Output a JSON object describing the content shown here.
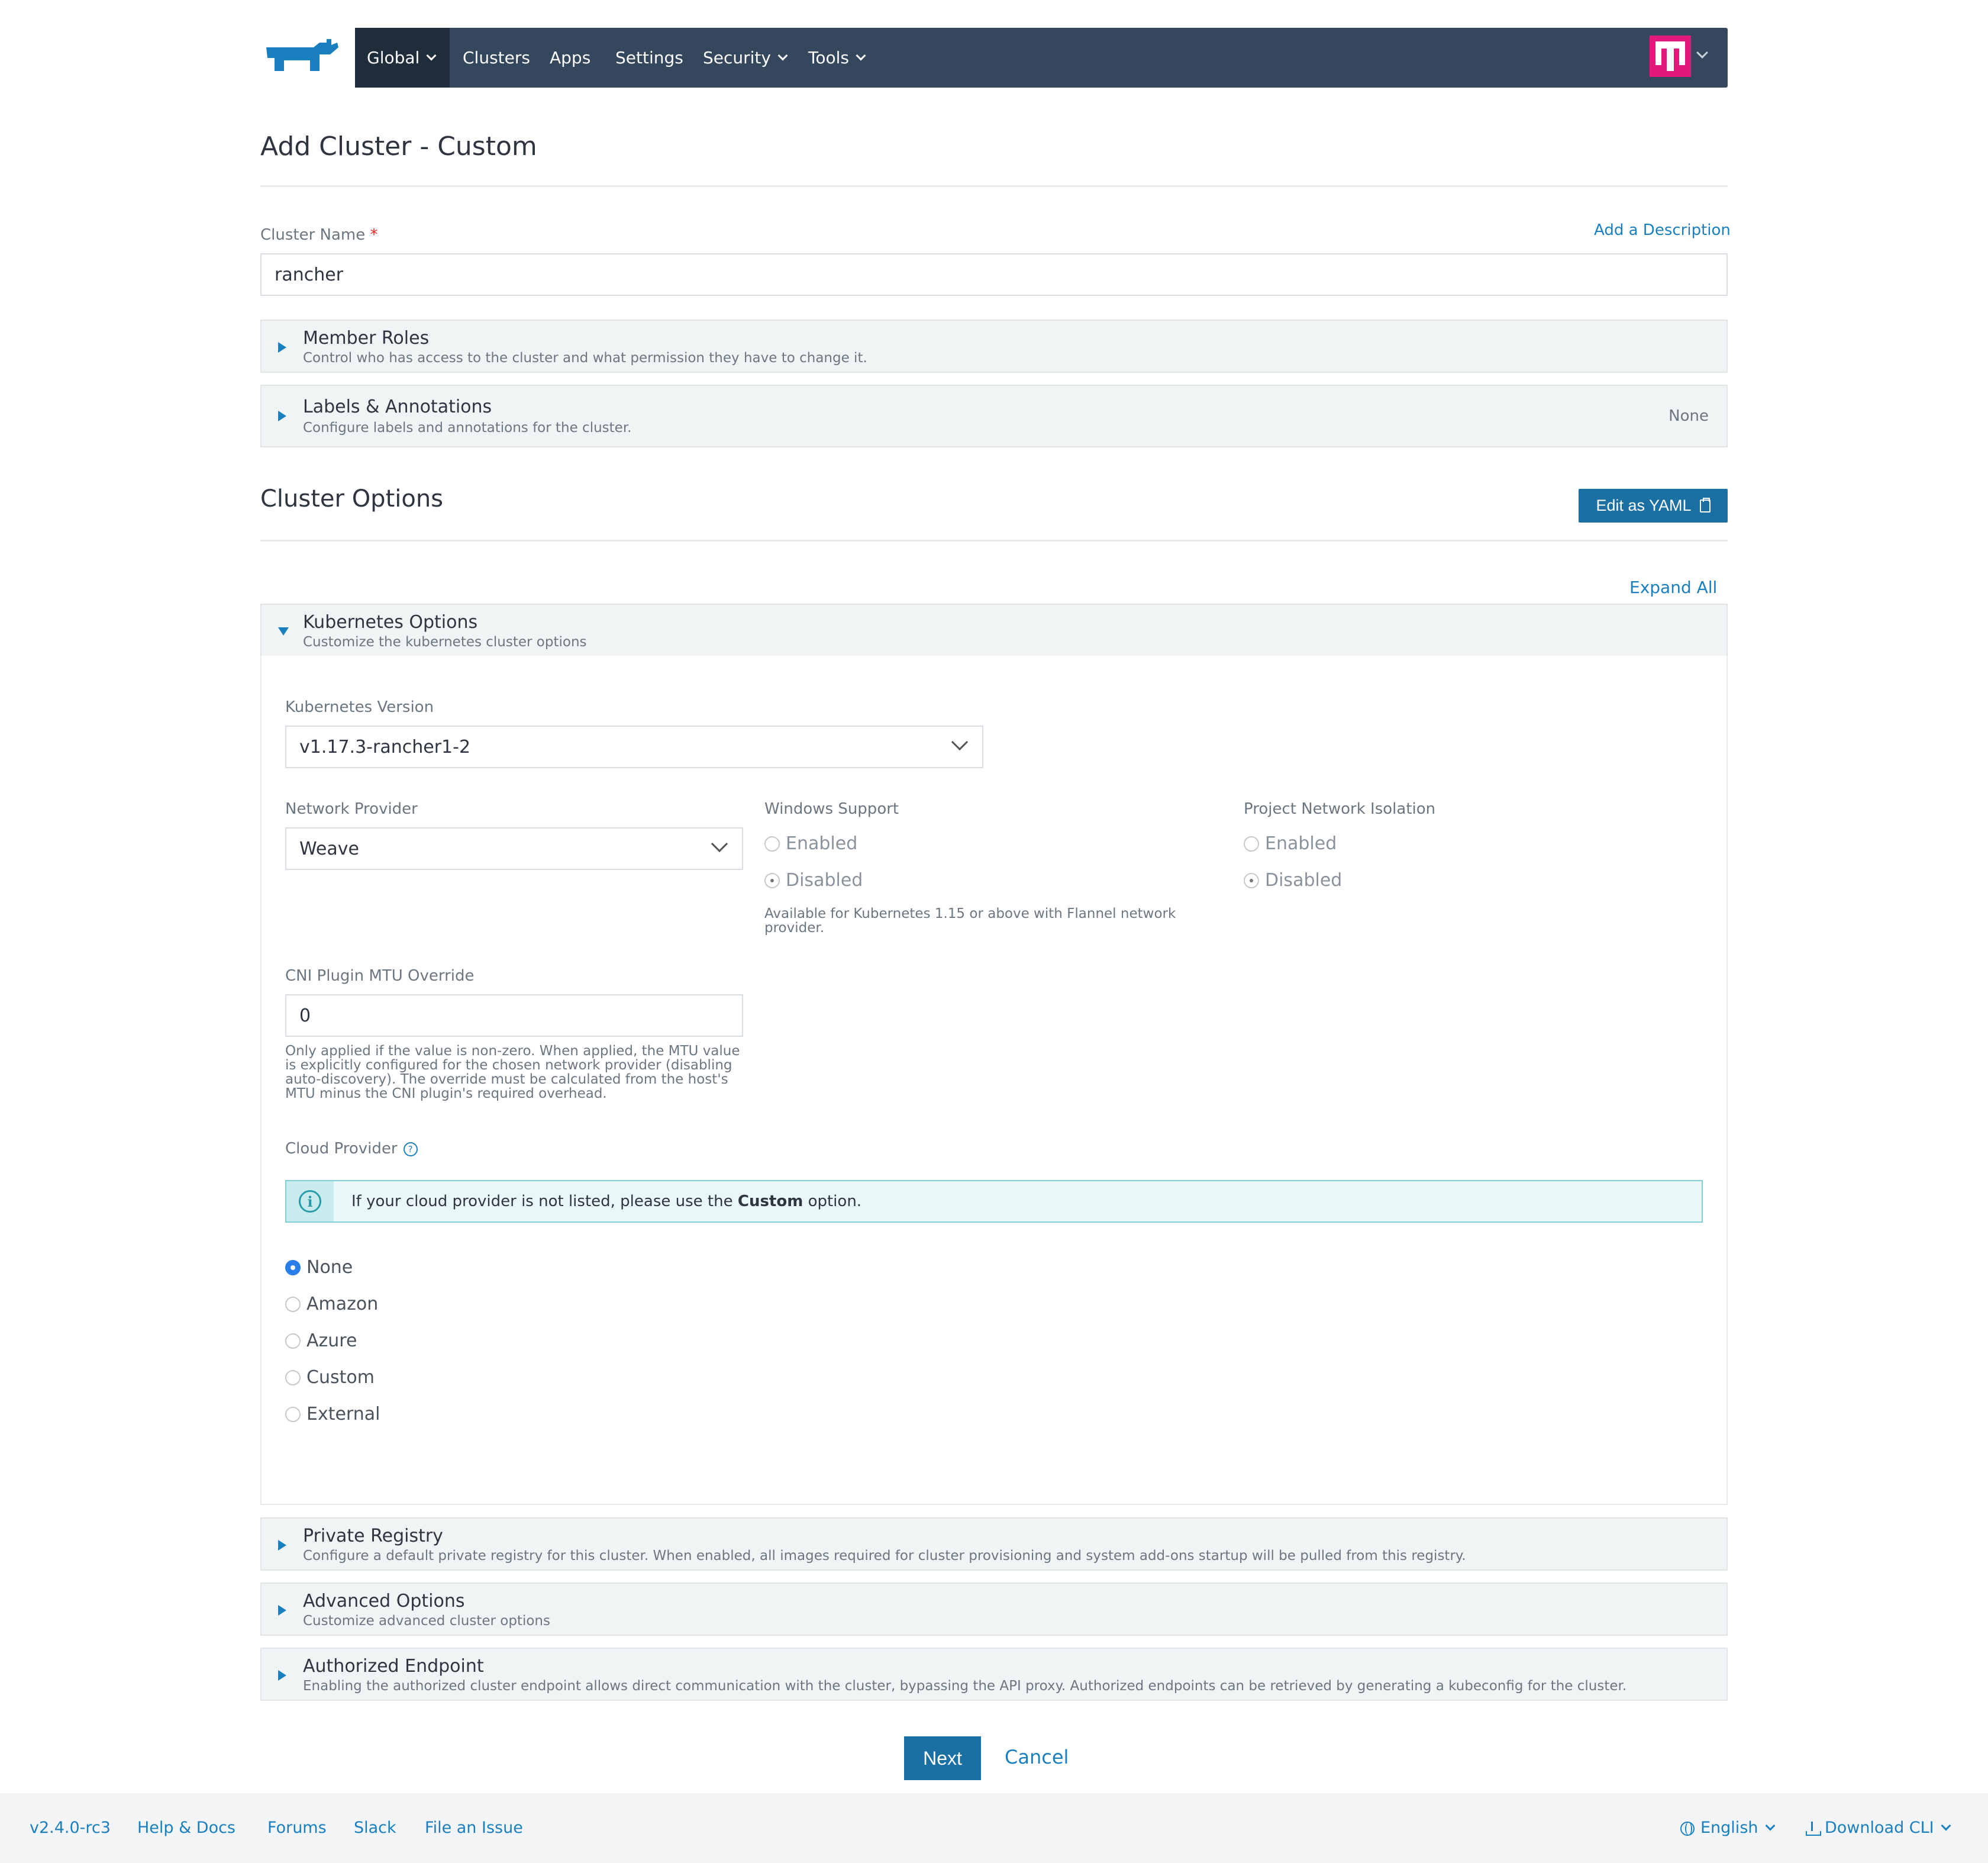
{
  "nav": {
    "global": "Global",
    "items": [
      "Clusters",
      "Apps",
      "Settings",
      "Security",
      "Tools"
    ]
  },
  "page": {
    "title": "Add Cluster - Custom",
    "cluster_name_label": "Cluster Name",
    "required_mark": "*",
    "add_description": "Add a Description",
    "cluster_name_value": "rancher"
  },
  "accordions": {
    "member_roles": {
      "title": "Member Roles",
      "desc": "Control who has access to the cluster and what permission they have to change it."
    },
    "labels": {
      "title": "Labels & Annotations",
      "desc": "Configure labels and annotations for the cluster.",
      "status": "None"
    },
    "kubernetes": {
      "title": "Kubernetes Options",
      "desc": "Customize the kubernetes cluster options"
    },
    "registry": {
      "title": "Private Registry",
      "desc": "Configure a default private registry for this cluster. When enabled, all images required for cluster provisioning and system add-ons startup will be pulled from this registry."
    },
    "advanced": {
      "title": "Advanced Options",
      "desc": "Customize advanced cluster options"
    },
    "endpoint": {
      "title": "Authorized Endpoint",
      "desc": "Enabling the authorized cluster endpoint allows direct communication with the cluster, bypassing the API proxy. Authorized endpoints can be retrieved by generating a kubeconfig for the cluster."
    }
  },
  "cluster_options": {
    "title": "Cluster Options",
    "edit_yaml": "Edit as YAML",
    "expand_all": "Expand All"
  },
  "k8s": {
    "version_label": "Kubernetes Version",
    "version_value": "v1.17.3-rancher1-2",
    "network_label": "Network Provider",
    "network_value": "Weave",
    "windows_label": "Windows Support",
    "windows_options": [
      "Enabled",
      "Disabled"
    ],
    "windows_help": "Available for Kubernetes 1.15 or above with Flannel network provider.",
    "isolation_label": "Project Network Isolation",
    "isolation_options": [
      "Enabled",
      "Disabled"
    ],
    "mtu_label": "CNI Plugin MTU Override",
    "mtu_value": "0",
    "mtu_help": "Only applied if the value is non-zero. When applied, the MTU value is explicitly configured for the chosen network provider (disabling auto-discovery). The override must be calculated from the host's MTU minus the CNI plugin's required overhead.",
    "cloud_label": "Cloud Provider",
    "cloud_info_before": "If your cloud provider is not listed, please use the ",
    "cloud_info_bold": "Custom",
    "cloud_info_after": " option.",
    "cloud_options": [
      "None",
      "Amazon",
      "Azure",
      "Custom",
      "External"
    ],
    "cloud_selected": "None"
  },
  "actions": {
    "next": "Next",
    "cancel": "Cancel"
  },
  "footer": {
    "version": "v2.4.0-rc3",
    "links": [
      "Help & Docs",
      "Forums",
      "Slack",
      "File an Issue"
    ],
    "language": "English",
    "download": "Download CLI"
  },
  "colors": {
    "nav_bg": "#34475c",
    "accent": "#1a6fa3",
    "avatar": "#e0197a"
  },
  "icons": [
    "rancher-logo-icon",
    "chevron-down-icon",
    "clipboard-icon",
    "triangle-right-icon",
    "info-icon",
    "question-icon",
    "globe-icon",
    "download-icon"
  ]
}
